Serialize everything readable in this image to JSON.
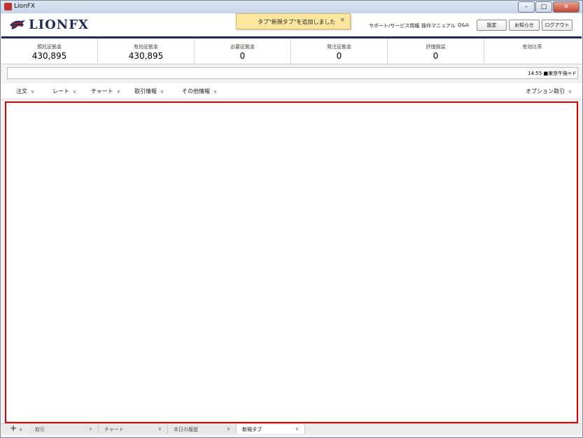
{
  "window": {
    "title": "LionFX"
  },
  "header": {
    "logo_text": "LIONFX",
    "toast_message": "タブ\"新規タブ\"を追加しました",
    "toast_close": "×",
    "links": [
      "サポート/サービス情報",
      "操作マニュアル",
      "Q&A"
    ],
    "buttons": {
      "settings": "設定",
      "notices": "お知らせ",
      "logout": "ログアウト"
    }
  },
  "stats": [
    {
      "label": "預託証拠金",
      "value": "430,895"
    },
    {
      "label": "有効証拠金",
      "value": "430,895"
    },
    {
      "label": "必要証拠金",
      "value": "0"
    },
    {
      "label": "発注証拠金",
      "value": "0"
    },
    {
      "label": "評価損益",
      "value": "0"
    },
    {
      "label": "有効比率",
      "value": ""
    }
  ],
  "ticker": {
    "text": "14:55 ■東京午後=ド"
  },
  "menu": {
    "items": [
      "注文",
      "レート",
      "チャート",
      "取引情報",
      "その他情報"
    ],
    "right_item": "オプション取引",
    "chevron": "∨"
  },
  "tabs": {
    "add": "+",
    "items": [
      {
        "label": "取引"
      },
      {
        "label": "チャート"
      },
      {
        "label": "本日の履歴"
      },
      {
        "label": "新規タブ"
      }
    ]
  },
  "colors": {
    "brand": "#1f2c5a",
    "highlight": "#e00000",
    "toast_bg": "#fde7a0"
  }
}
